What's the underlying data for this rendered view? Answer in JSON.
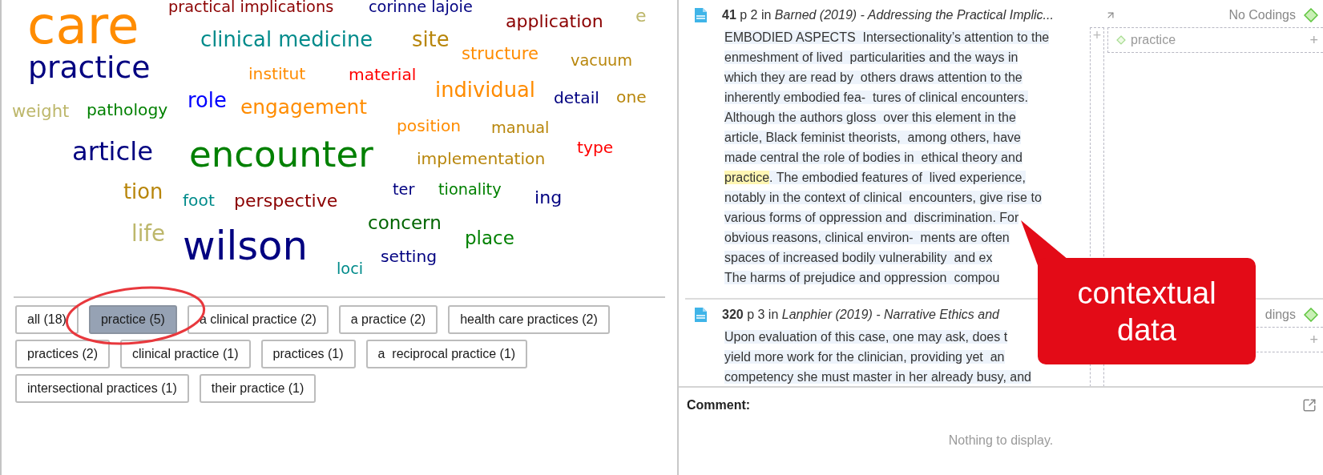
{
  "word_cloud": {
    "words": [
      {
        "text": "care",
        "color": "#ff8c00"
      },
      {
        "text": "practical implications",
        "color": "#8b0000"
      },
      {
        "text": "corinne lajoie",
        "color": "#000080"
      },
      {
        "text": "application",
        "color": "#8b0000"
      },
      {
        "text": "e",
        "color": "#bdb76b"
      },
      {
        "text": "practice",
        "color": "#000080"
      },
      {
        "text": "clinical medicine",
        "color": "#008b8b"
      },
      {
        "text": "institut",
        "color": "#ff8c00"
      },
      {
        "text": "material",
        "color": "#ff0000"
      },
      {
        "text": "site",
        "color": "#b8860b"
      },
      {
        "text": "structure",
        "color": "#ff8c00"
      },
      {
        "text": "vacuum",
        "color": "#b8860b"
      },
      {
        "text": "weight",
        "color": "#bdb76b"
      },
      {
        "text": "pathology",
        "color": "#008000"
      },
      {
        "text": "role",
        "color": "#0000ff"
      },
      {
        "text": "engagement",
        "color": "#ff8c00"
      },
      {
        "text": "position",
        "color": "#ff8c00"
      },
      {
        "text": "individual",
        "color": "#ff8c00"
      },
      {
        "text": "manual",
        "color": "#b8860b"
      },
      {
        "text": "detail",
        "color": "#000080"
      },
      {
        "text": "one",
        "color": "#b8860b"
      },
      {
        "text": "article",
        "color": "#000080"
      },
      {
        "text": "encounter",
        "color": "#008000"
      },
      {
        "text": "implementation",
        "color": "#b8860b"
      },
      {
        "text": "type",
        "color": "#ff0000"
      },
      {
        "text": "tion",
        "color": "#b8860b"
      },
      {
        "text": "foot",
        "color": "#008b8b"
      },
      {
        "text": "perspective",
        "color": "#8b0000"
      },
      {
        "text": "ter",
        "color": "#000080"
      },
      {
        "text": "tionality",
        "color": "#008000"
      },
      {
        "text": "ing",
        "color": "#000080"
      },
      {
        "text": "life",
        "color": "#bdb76b"
      },
      {
        "text": "wilson",
        "color": "#000080"
      },
      {
        "text": "loci",
        "color": "#008b8b"
      },
      {
        "text": "concern",
        "color": "#006400"
      },
      {
        "text": "setting",
        "color": "#000080"
      },
      {
        "text": "place",
        "color": "#008000"
      }
    ]
  },
  "filters": [
    {
      "label": "all (18)",
      "selected": false
    },
    {
      "label": "practice (5)",
      "selected": true
    },
    {
      "label": "a clinical practice (2)",
      "selected": false
    },
    {
      "label": "a practice (2)",
      "selected": false
    },
    {
      "label": "health care practices (2)",
      "selected": false
    },
    {
      "label": "practices (2)",
      "selected": false
    },
    {
      "label": "clinical practice (1)",
      "selected": false
    },
    {
      "label": "practices (1)",
      "selected": false
    },
    {
      "label": "a  reciprocal practice (1)",
      "selected": false
    },
    {
      "label": "intersectional practices (1)",
      "selected": false
    },
    {
      "label": "their practice (1)",
      "selected": false
    }
  ],
  "entries": [
    {
      "title": "**41** p 2 in *Barned (2019) - Addressing the Practical Implic...*",
      "codings": "No Codings",
      "column_plus": "+",
      "code": {
        "label": "practice",
        "plus": "+"
      },
      "segments": [
        {
          "text": "EMBODIED ASPECTS  Intersectionality’s attention to the\nenmeshment of lived  particularities and the ways in\nwhich they are read by  others draws attention to the\ninherently embodied fea-  tures of clinical encounters.\nAlthough the authors gloss  over this element in the\narticle, Black feminist theorists,  among others, have\nmade central the role of bodies in  ethical theory and\n",
          "highlighted": false
        },
        {
          "text": "practice",
          "highlighted": true
        },
        {
          "text": ". The embodied features of  lived experience,\nnotably in the context of clinical  encounters, give rise to\nvarious forms of oppression and  discrimination. For\nobvious reasons, clinical environ-  ments are often\nspaces of increased bodily vulnerability  and ex\nThe harms of prejudice and oppression  compou",
          "highlighted": false
        }
      ]
    },
    {
      "title": "**320** p 3 in *Lanphier (2019) - Narrative Ethics and*",
      "codings": "dings",
      "code": {
        "plus": "+"
      },
      "segments": [
        {
          "text": "Upon evaluation of this case, one may ask, does t\nyield more work for the clinician, providing yet  an\ncompetency she must master in her already busy, and",
          "highlighted": false
        }
      ]
    }
  ],
  "comment": {
    "label": "Comment:",
    "empty_text": "Nothing to display."
  },
  "annotation": {
    "callout_text": "contextual data"
  }
}
